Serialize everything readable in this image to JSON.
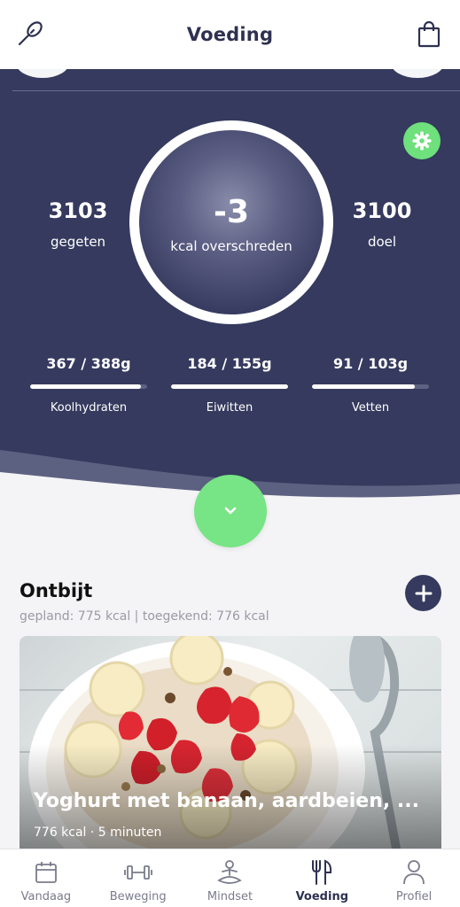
{
  "header": {
    "title": "Voeding",
    "left_icon": "whisk-icon",
    "right_icon": "shopping-bag-icon"
  },
  "summary": {
    "eaten_value": "3103",
    "eaten_label": "gegeten",
    "center_value": "-3",
    "center_label": "kcal overschreden",
    "goal_value": "3100",
    "goal_label": "doel",
    "settings_icon": "gear-icon"
  },
  "macros": [
    {
      "value": "367 / 388g",
      "name": "Koolhydraten",
      "progress": 0.95
    },
    {
      "value": "184 / 155g",
      "name": "Eiwitten",
      "progress": 1.0
    },
    {
      "value": "91 / 103g",
      "name": "Vetten",
      "progress": 0.88
    }
  ],
  "meal": {
    "title": "Ontbijt",
    "subtitle": "gepland: 775 kcal | toegekend: 776 kcal",
    "card_title": "Yoghurt met banaan, aardbeien, ...",
    "card_meta": "776 kcal · 5 minuten"
  },
  "tabs": [
    {
      "label": "Vandaag",
      "icon": "calendar-icon",
      "active": false
    },
    {
      "label": "Beweging",
      "icon": "dumbbell-icon",
      "active": false
    },
    {
      "label": "Mindset",
      "icon": "meditation-icon",
      "active": false
    },
    {
      "label": "Voeding",
      "icon": "fork-knife-icon",
      "active": true
    },
    {
      "label": "Profiel",
      "icon": "person-icon",
      "active": false
    }
  ],
  "colors": {
    "hero_bg": "#353a5e",
    "accent_green": "#77e585",
    "active_tab": "#2e3150"
  }
}
